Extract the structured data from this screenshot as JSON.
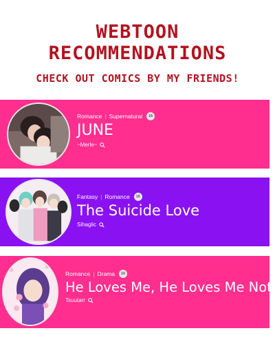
{
  "header": {
    "title_line1": "WEBTOON",
    "title_line2": "RECOMMENDATIONS",
    "subtitle": "CHECK OUT COMICS BY MY FRIENDS!"
  },
  "colors": {
    "title": "#b3121f",
    "card_pink": "#ff2e8f",
    "card_purple": "#8a12f2"
  },
  "cards": [
    {
      "genre1": "Romance",
      "genre2": "Supernatural",
      "age_badge": "16",
      "title": "JUNE",
      "author": "~Merle~",
      "color": "#ff2e8f"
    },
    {
      "genre1": "Fantasy",
      "genre2": "Romance",
      "age_badge": "16",
      "title": "The Suicide Love",
      "author": "Sihaglic",
      "color": "#8a12f2"
    },
    {
      "genre1": "Romance",
      "genre2": "Drama",
      "age_badge": "16",
      "title": "He Loves Me, He Loves Me Not",
      "author": "Tsuutarr",
      "color": "#ff2e8f"
    }
  ]
}
